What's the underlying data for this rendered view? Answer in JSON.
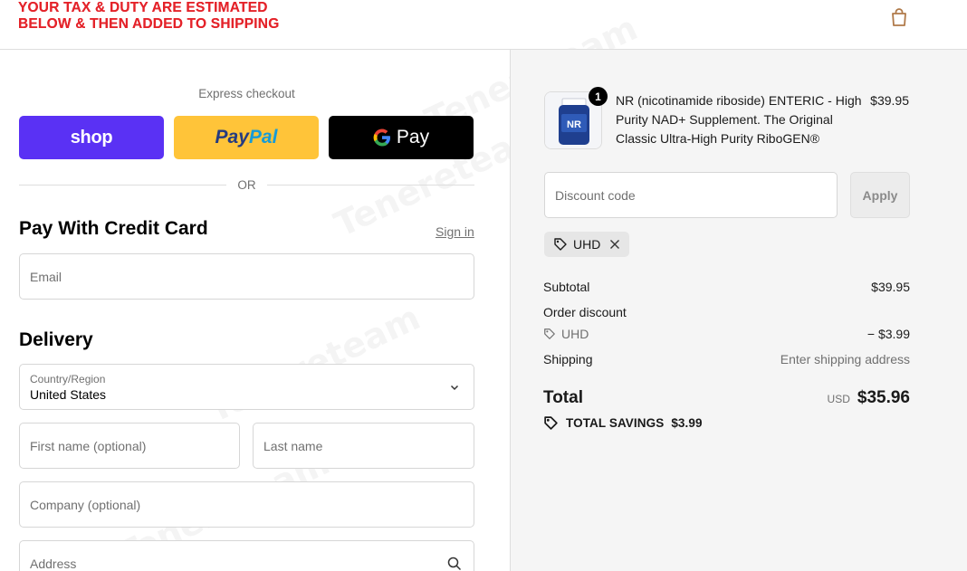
{
  "banner": {
    "line1": "YOUR TAX & DUTY ARE ESTIMATED",
    "line2": "BELOW & THEN ADDED TO SHIPPING"
  },
  "header": {
    "cart_icon": "shopping-bag-icon"
  },
  "express": {
    "label": "Express checkout",
    "shop_label": "shop",
    "paypal_pay": "Pay",
    "paypal_pal": "Pal",
    "gpay_label": "Pay",
    "or_label": "OR"
  },
  "credit": {
    "title": "Pay With Credit Card",
    "sign_in": "Sign in",
    "email_placeholder": "Email"
  },
  "delivery": {
    "title": "Delivery",
    "country_label": "Country/Region",
    "country_value": "United States",
    "first_name_placeholder": "First name (optional)",
    "last_name_placeholder": "Last name",
    "company_placeholder": "Company (optional)",
    "address_placeholder": "Address"
  },
  "summary": {
    "product": {
      "quantity": "1",
      "name": "NR (nicotinamide riboside) ENTERIC - High Purity NAD+ Supplement. The Original Classic Ultra-High Purity RiboGEN®",
      "price": "$39.95",
      "thumb_label": "NR"
    },
    "discount_placeholder": "Discount code",
    "apply_label": "Apply",
    "applied_code": "UHD",
    "subtotal_label": "Subtotal",
    "subtotal_value": "$39.95",
    "order_discount_label": "Order discount",
    "discount_code": "UHD",
    "discount_value": "− $3.99",
    "shipping_label": "Shipping",
    "shipping_value": "Enter shipping address",
    "total_label": "Total",
    "total_currency": "USD",
    "total_value": "$35.96",
    "savings_label": "TOTAL SAVINGS",
    "savings_value": "$3.99"
  },
  "watermark": "Tenereteam",
  "colors": {
    "banner_red": "#e4232a",
    "shop_purple": "#5a31f4",
    "paypal_yellow": "#ffc439",
    "paypal_navy": "#253b80",
    "paypal_blue": "#179bd7"
  }
}
